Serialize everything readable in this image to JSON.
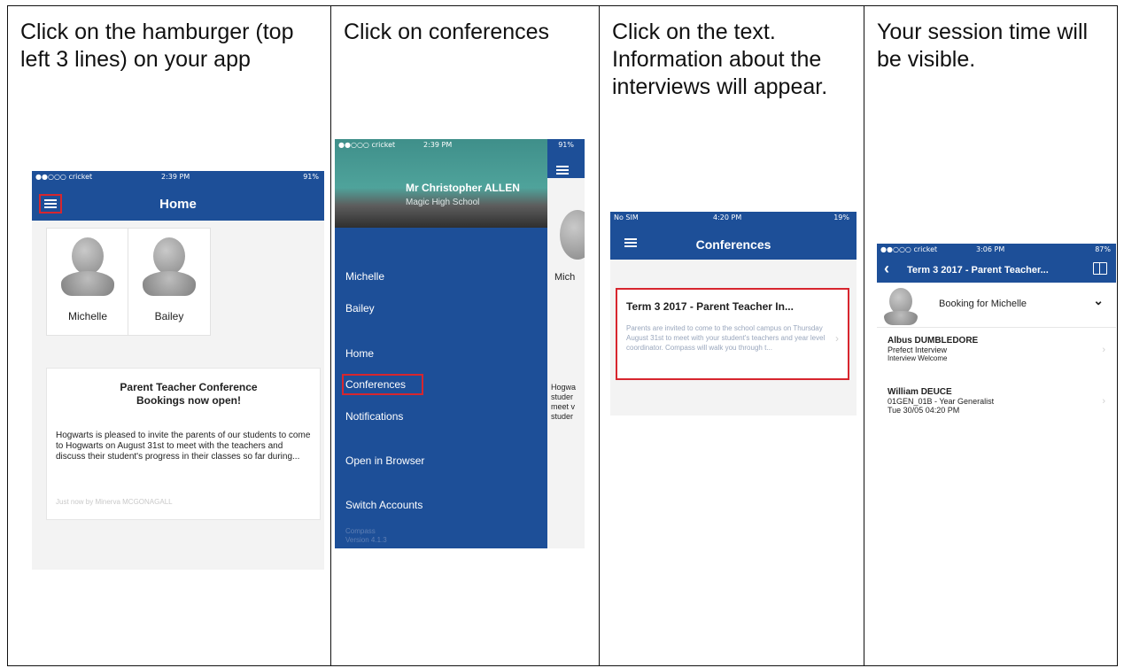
{
  "steps": [
    {
      "instruction": "Click on the hamburger (top left 3 lines) on your app"
    },
    {
      "instruction": "Click on conferences"
    },
    {
      "instruction": "Click on the text. Information about the interviews will appear."
    },
    {
      "instruction": "Your session time will be visible."
    }
  ],
  "screen1": {
    "carrier": "●●○○○ cricket",
    "time": "2:39 PM",
    "battery": "91%",
    "title": "Home",
    "students": [
      "Michelle",
      "Bailey"
    ],
    "news_title": "Parent Teacher Conference Bookings now open!",
    "news_body": "Hogwarts is pleased to invite the parents of our students to come to Hogwarts on August 31st to meet with the teachers and discuss their student's progress in their classes so far during...",
    "news_meta": "Just now by Minerva MCGONAGALL"
  },
  "screen2": {
    "carrier": "●●○○○ cricket",
    "time": "2:39 PM",
    "battery": "91%",
    "user_name": "Mr Christopher ALLEN",
    "school": "Magic High School",
    "menu": [
      "Michelle",
      "Bailey",
      "Home",
      "Conferences",
      "Notifications",
      "Open in Browser",
      "Switch Accounts"
    ],
    "app_name": "Compass",
    "version": "Version 4.1.3",
    "behind_name": "Mich",
    "behind_text": "Hogwa studer meet v studer"
  },
  "screen3": {
    "carrier": "No SIM",
    "time": "4:20 PM",
    "battery": "19%",
    "title": "Conferences",
    "conf_title": "Term 3 2017 - Parent Teacher In...",
    "conf_body": "Parents are invited to come to the school campus on Thursday August 31st to meet with your student's teachers and year level coordinator. Compass will walk you through t..."
  },
  "screen4": {
    "carrier": "●●○○○ cricket",
    "time": "3:06 PM",
    "battery": "87%",
    "title": "Term 3 2017 - Parent Teacher...",
    "booking_label": "Booking for Michelle",
    "interviews": [
      {
        "name": "Albus DUMBLEDORE",
        "line1": "Prefect Interview",
        "line2": "Interview Welcome"
      },
      {
        "name": "William DEUCE",
        "line1": "01GEN_01B - Year  Generalist",
        "line2": "Tue 30/05 04:20 PM"
      }
    ]
  },
  "colors": {
    "navbar": "#1d4f98",
    "highlight": "#d7262e"
  }
}
